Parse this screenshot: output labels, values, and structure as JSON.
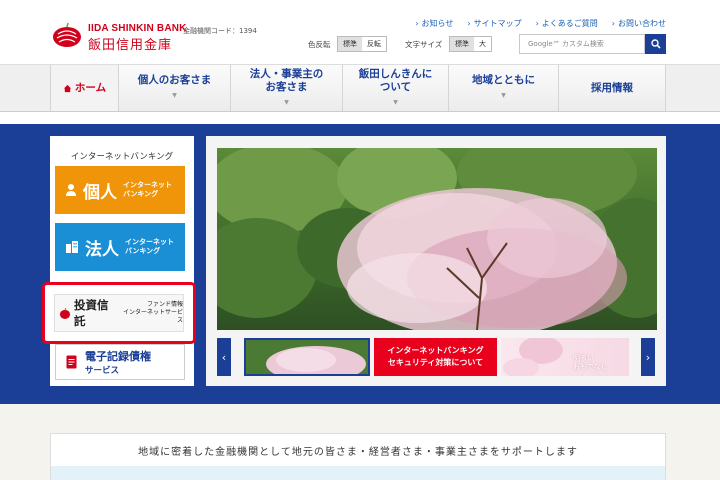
{
  "header": {
    "logo_en": "IIDA SHINKIN BANK",
    "logo_jp": "飯田信用金庫",
    "code_label": "金融機関コード：1394",
    "links": [
      {
        "label": "お知らせ"
      },
      {
        "label": "サイトマップ"
      },
      {
        "label": "よくあるご質問"
      },
      {
        "label": "お問い合わせ"
      }
    ],
    "color_label": "色反転",
    "color_options": [
      "標準",
      "反転"
    ],
    "font_label": "文字サイズ",
    "font_options": [
      "標準",
      "大"
    ],
    "search_placeholder": "Google™ カスタム検索"
  },
  "nav": {
    "items": [
      {
        "label": "ホーム"
      },
      {
        "label": "個人のお客さま"
      },
      {
        "label": "法人・事業主の",
        "label2": "お客さま"
      },
      {
        "label": "飯田しんきんに",
        "label2": "ついて"
      },
      {
        "label": "地域とともに"
      },
      {
        "label": "採用情報"
      }
    ]
  },
  "sidebar": {
    "title": "インターネットバンキング",
    "personal": {
      "big": "個人",
      "small1": "インターネット",
      "small2": "バンキング"
    },
    "corporate": {
      "big": "法人",
      "small1": "インターネット",
      "small2": "バンキング"
    },
    "investment": {
      "title": "投資信託",
      "sub1": "ファンド情報",
      "sub2": "インターネットサービス"
    },
    "ecredit": {
      "line1": "電子記録債権",
      "line2": "サービス"
    }
  },
  "carousel": {
    "thumb_red_line1": "インターネットバンキング",
    "thumb_red_line2": "セキュリティ対策について",
    "thumb_pink_line1": "明るい",
    "thumb_pink_line2": "おもてなし"
  },
  "banner": {
    "text": "地域に密着した金融機関として地元の皆さま・経営者さま・事業主さまをサポートします"
  },
  "colors": {
    "brand_red": "#d0021b",
    "navy": "#1b3f96",
    "orange": "#f0950a",
    "sky": "#1a8fd6"
  }
}
